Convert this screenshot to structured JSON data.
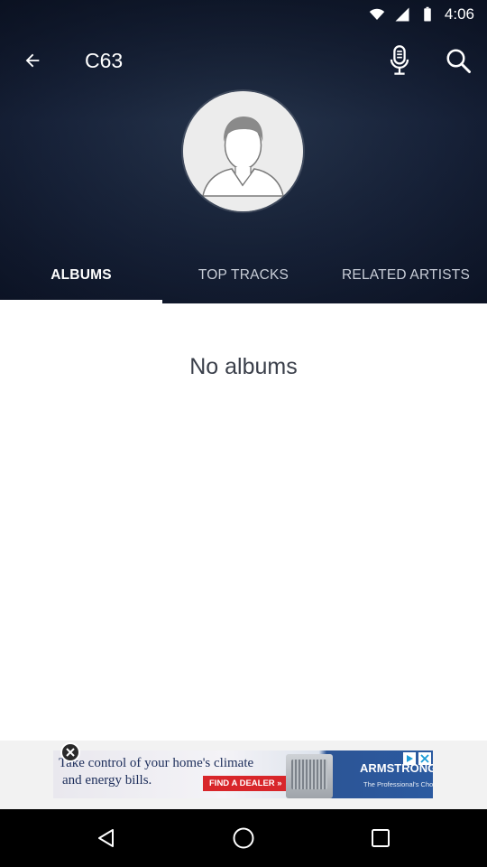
{
  "status_bar": {
    "time": "4:06",
    "icons": [
      "wifi-icon",
      "cellular-icon",
      "battery-icon"
    ]
  },
  "header": {
    "title": "C63",
    "icons": [
      "back-arrow-icon",
      "microphone-icon",
      "search-icon"
    ],
    "avatar": "default-artist-avatar"
  },
  "tabs": [
    {
      "label": "ALBUMS",
      "active": true
    },
    {
      "label": "TOP TRACKS",
      "active": false
    },
    {
      "label": "RELATED ARTISTS",
      "active": false
    }
  ],
  "content": {
    "empty_message": "No albums"
  },
  "ad": {
    "line1": "Take control of your home's climate",
    "line2": "and energy bills.",
    "cta": "FIND A DEALER »",
    "brand": "ARMSTRONG AIR",
    "brand_tagline": "The Professional's Choice",
    "close_icon": "close-circle-icon"
  },
  "nav_bar": {
    "icons": [
      "back-triangle-icon",
      "home-circle-icon",
      "recents-square-icon"
    ]
  },
  "colors": {
    "header_bg": "#1b2740",
    "tab_active": "#ffffff",
    "tab_inactive": "#c9ced8",
    "empty_text": "#3a3f4a"
  }
}
